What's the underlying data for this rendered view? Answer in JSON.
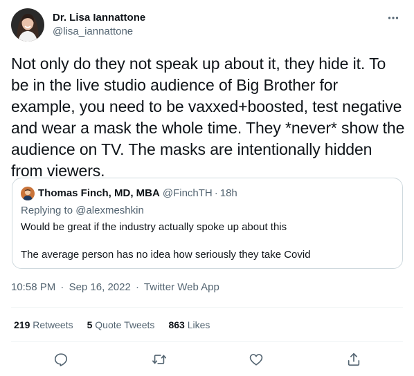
{
  "author": {
    "display_name": "Dr. Lisa Iannattone",
    "handle": "@lisa_iannattone"
  },
  "menu": {
    "icon": "more-horizontal-icon"
  },
  "tweet": {
    "text": "Not only do they not speak up about it, they hide it. To be in the live studio audience of Big Brother for example, you need to be vaxxed+boosted, test negative and wear a mask the whole time. They *never* show the audience on TV. The masks are intentionally hidden from viewers."
  },
  "quoted_tweet": {
    "display_name": "Thomas Finch, MD, MBA",
    "handle": "@FinchTH",
    "separator": "·",
    "time": "18h",
    "replying_prefix": "Replying to",
    "replying_user": "@alexmeshkin",
    "line1": "Would be great if the industry actually spoke up about this",
    "line2": "The average person has no idea how seriously they take Covid"
  },
  "meta": {
    "time": "10:58 PM",
    "separator": "·",
    "date": "Sep 16, 2022",
    "app": "Twitter Web App"
  },
  "stats": {
    "retweets": {
      "count": "219",
      "label": "Retweets"
    },
    "quotes": {
      "count": "5",
      "label": "Quote Tweets"
    },
    "likes": {
      "count": "863",
      "label": "Likes"
    }
  },
  "actions": [
    "reply-icon",
    "retweet-icon",
    "like-icon",
    "share-icon"
  ],
  "colors": {
    "text": "#0f1419",
    "secondary": "#536471",
    "border": "#cfd9de",
    "divider": "#eff3f4"
  }
}
